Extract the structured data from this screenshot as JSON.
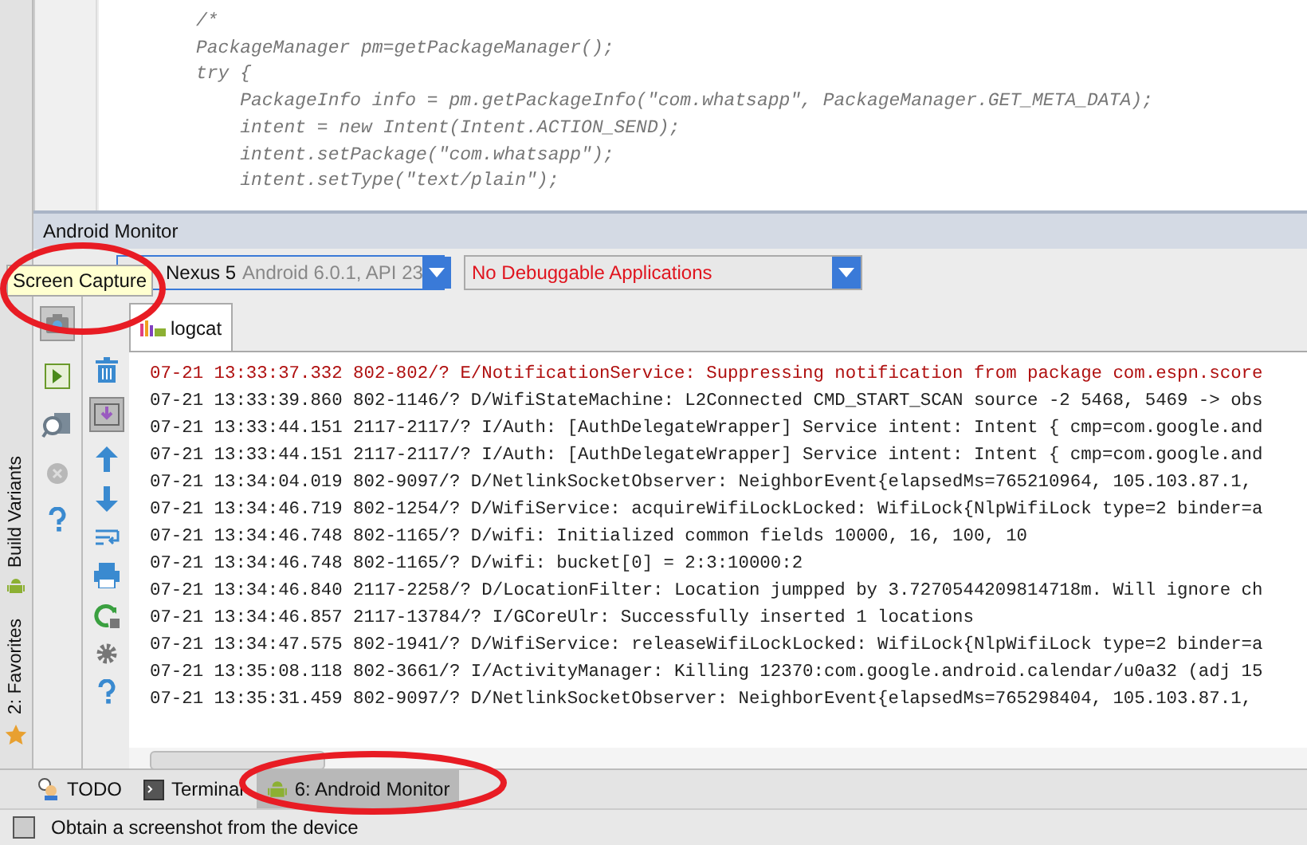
{
  "side_tabs": [
    {
      "label": "Build Variants",
      "kind": "android"
    },
    {
      "label": "2: Favorites",
      "kind": "star"
    }
  ],
  "editor": {
    "lines": [
      "/*",
      "PackageManager pm=getPackageManager();",
      "try {",
      "    PackageInfo info = pm.getPackageInfo(\"com.whatsapp\", PackageManager.GET_META_DATA);",
      "    intent = new Intent(Intent.ACTION_SEND);",
      "    intent.setPackage(\"com.whatsapp\");",
      "    intent.setType(\"text/plain\");"
    ]
  },
  "monitor": {
    "title": "Android Monitor",
    "device": {
      "name": "Nexus 5",
      "detail": "Android 6.0.1, API 23"
    },
    "app": "No Debuggable Applications",
    "tooltip": "Screen Capture",
    "tabs": [
      {
        "label": "logcat",
        "selected": true
      }
    ],
    "log": [
      {
        "kind": "error",
        "text": "07-21 13:33:37.332 802-802/? E/NotificationService: Suppressing notification from package com.espn.score"
      },
      {
        "kind": "debug",
        "text": "07-21 13:33:39.860 802-1146/? D/WifiStateMachine: L2Connected CMD_START_SCAN source -2 5468, 5469 -> obs"
      },
      {
        "kind": "debug",
        "text": "07-21 13:33:44.151 2117-2117/? I/Auth: [AuthDelegateWrapper] Service intent: Intent { cmp=com.google.and"
      },
      {
        "kind": "debug",
        "text": "07-21 13:33:44.151 2117-2117/? I/Auth: [AuthDelegateWrapper] Service intent: Intent { cmp=com.google.and"
      },
      {
        "kind": "debug",
        "text": "07-21 13:34:04.019 802-9097/? D/NetlinkSocketObserver: NeighborEvent{elapsedMs=765210964, 105.103.87.1,"
      },
      {
        "kind": "debug",
        "text": "07-21 13:34:46.719 802-1254/? D/WifiService: acquireWifiLockLocked: WifiLock{NlpWifiLock type=2 binder=a"
      },
      {
        "kind": "debug",
        "text": "07-21 13:34:46.748 802-1165/? D/wifi: Initialized common fields 10000, 16, 100, 10"
      },
      {
        "kind": "debug",
        "text": "07-21 13:34:46.748 802-1165/? D/wifi: bucket[0] = 2:3:10000:2"
      },
      {
        "kind": "debug",
        "text": "07-21 13:34:46.840 2117-2258/? D/LocationFilter: Location jumpped by 3.7270544209814718m. Will ignore ch"
      },
      {
        "kind": "debug",
        "text": "07-21 13:34:46.857 2117-13784/? I/GCoreUlr: Successfully inserted 1 locations"
      },
      {
        "kind": "debug",
        "text": "07-21 13:34:47.575 802-1941/? D/WifiService: releaseWifiLockLocked: WifiLock{NlpWifiLock type=2 binder=a"
      },
      {
        "kind": "debug",
        "text": "07-21 13:35:08.118 802-3661/? I/ActivityManager: Killing 12370:com.google.android.calendar/u0a32 (adj 15"
      },
      {
        "kind": "debug",
        "text": "07-21 13:35:31.459 802-9097/? D/NetlinkSocketObserver: NeighborEvent{elapsedMs=765298404, 105.103.87.1,"
      }
    ]
  },
  "bottom_tabs": [
    {
      "label": "TODO",
      "kind": "todo",
      "selected": false
    },
    {
      "label": "Terminal",
      "kind": "terminal",
      "selected": false
    },
    {
      "label": "6: Android Monitor",
      "kind": "android",
      "selected": true
    }
  ],
  "status": "Obtain a screenshot from the device"
}
